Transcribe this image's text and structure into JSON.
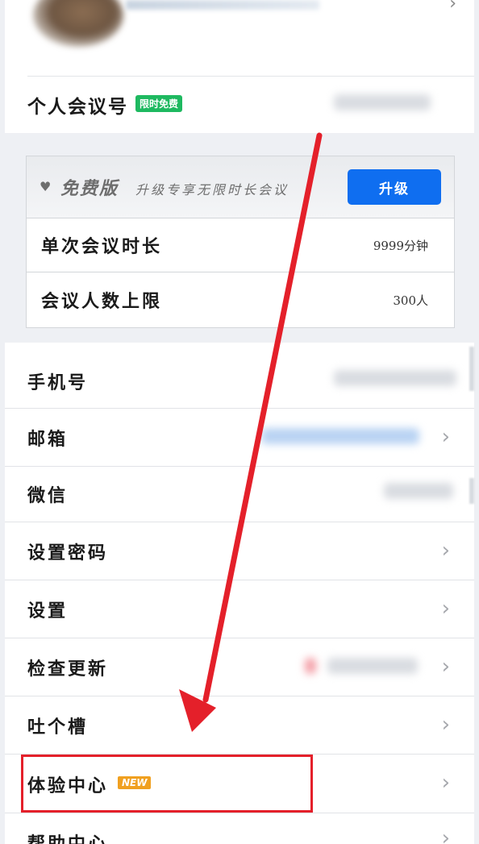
{
  "profile": {
    "meeting_id_label": "个人会议号",
    "free_badge": "限时免费"
  },
  "plan": {
    "name": "免费版",
    "promo": "升级专享无限时长会议",
    "upgrade_label": "升级",
    "rows": [
      {
        "label": "单次会议时长",
        "value": "9999分钟"
      },
      {
        "label": "会议人数上限",
        "value": "300人"
      }
    ]
  },
  "settings": {
    "items": [
      {
        "label": "手机号"
      },
      {
        "label": "邮箱"
      },
      {
        "label": "微信"
      },
      {
        "label": "设置密码"
      },
      {
        "label": "设置"
      },
      {
        "label": "检查更新"
      },
      {
        "label": "吐个槽"
      },
      {
        "label": "体验中心",
        "badge": "NEW"
      },
      {
        "label": "帮助中心"
      }
    ]
  },
  "icons": {
    "chevron": "chevron-right-icon",
    "plan": "heart-icon"
  },
  "colors": {
    "accent": "#0f6ef0",
    "badge_green": "#1eb960",
    "badge_new": "#f0a020",
    "annotation": "#e4202a"
  }
}
